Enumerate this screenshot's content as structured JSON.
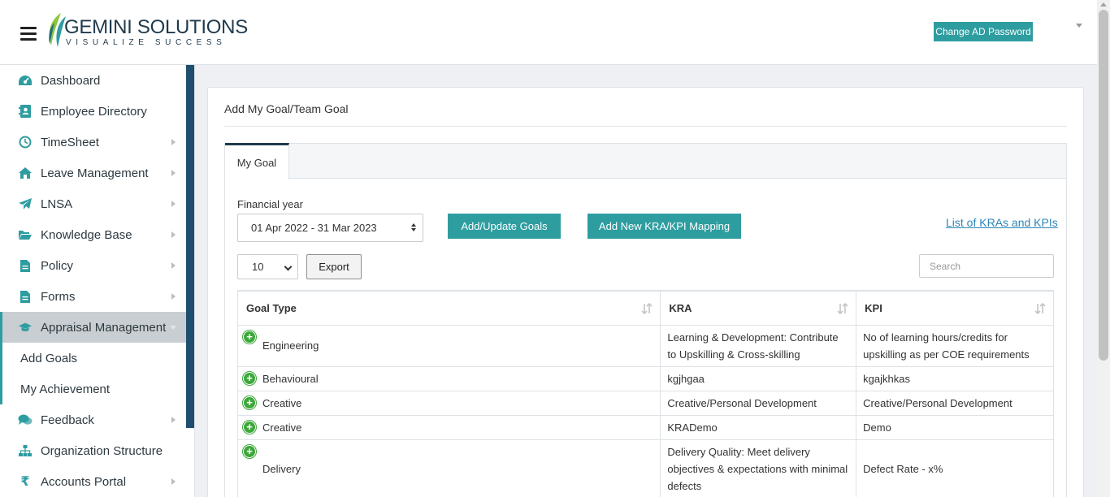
{
  "header": {
    "logo_name": "GEMINI SOLUTIONS",
    "logo_tagline": "VISUALIZE SUCCESS",
    "change_password_label": "Change AD Password"
  },
  "sidebar": {
    "items": [
      {
        "label": "Dashboard",
        "icon": "dashboard-icon"
      },
      {
        "label": "Employee Directory",
        "icon": "address-book-icon"
      },
      {
        "label": "TimeSheet",
        "icon": "clock-icon"
      },
      {
        "label": "Leave Management",
        "icon": "home-icon"
      },
      {
        "label": "LNSA",
        "icon": "paper-plane-icon"
      },
      {
        "label": "Knowledge Base",
        "icon": "folder-open-icon"
      },
      {
        "label": "Policy",
        "icon": "document-icon"
      },
      {
        "label": "Forms",
        "icon": "form-icon"
      },
      {
        "label": "Appraisal Management",
        "icon": "graduation-cap-icon"
      },
      {
        "label": "Feedback",
        "icon": "comments-icon"
      },
      {
        "label": "Organization Structure",
        "icon": "sitemap-icon"
      },
      {
        "label": "Accounts Portal",
        "icon": "rupee-icon"
      }
    ],
    "subitems": [
      {
        "label": "Add Goals"
      },
      {
        "label": "My Achievement"
      }
    ]
  },
  "main": {
    "title": "Add My Goal/Team Goal",
    "tab_label": "My Goal",
    "financial_year_label": "Financial year",
    "financial_year_value": "01 Apr 2022 - 31 Mar 2023",
    "add_update_label": "Add/Update Goals",
    "add_mapping_label": "Add New KRA/KPI Mapping",
    "list_link_label": "List of KRAs and KPIs",
    "page_length_value": "10",
    "export_label": "Export",
    "search_placeholder": "Search"
  },
  "table": {
    "columns": [
      "Goal Type",
      "KRA",
      "KPI"
    ],
    "rows": [
      {
        "goal_type": "Engineering",
        "kra": "Learning & Development: Contribute to Upskilling & Cross-skilling",
        "kpi": "No of learning hours/credits for upskilling as per COE requirements"
      },
      {
        "goal_type": "Behavioural",
        "kra": "kgjhgaa",
        "kpi": "kgajkhkas"
      },
      {
        "goal_type": "Creative",
        "kra": "Creative/Personal Development",
        "kpi": "Creative/Personal Development"
      },
      {
        "goal_type": "Creative",
        "kra": "KRADemo",
        "kpi": "Demo"
      },
      {
        "goal_type": "Delivery",
        "kra": "Delivery Quality: Meet delivery objectives & expectations with minimal defects",
        "kpi": "Defect Rate - x%"
      }
    ]
  },
  "colors": {
    "accent": "#2e9da0",
    "navy": "#1f4e6e",
    "plus_green": "#3da83a",
    "link": "#2e86b8"
  }
}
